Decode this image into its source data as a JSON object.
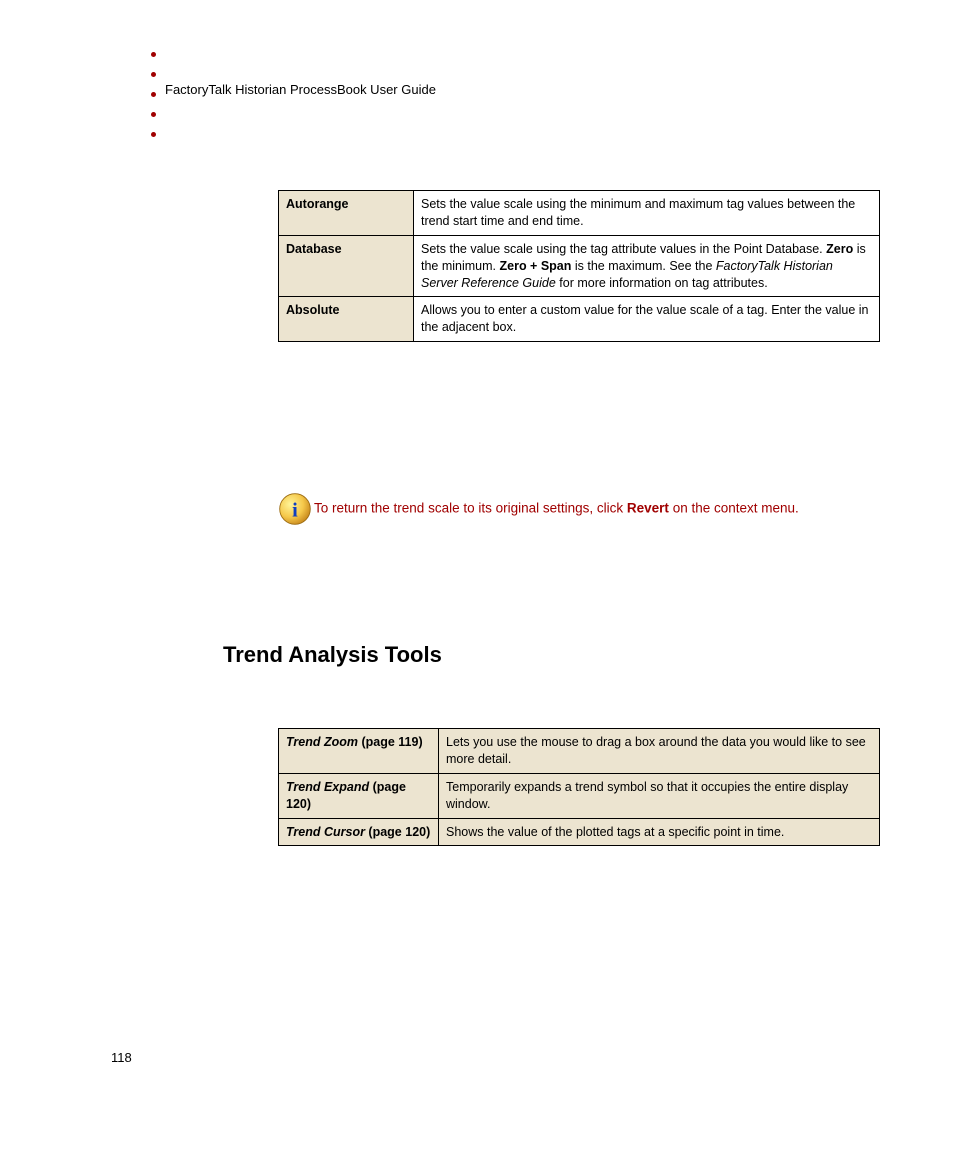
{
  "header": {
    "running_title": "FactoryTalk Historian ProcessBook User Guide"
  },
  "table1": {
    "rows": [
      {
        "label": "Autorange",
        "desc": "Sets the value scale using the minimum and maximum tag values between the trend start time and end time."
      },
      {
        "label": "Database",
        "desc_pre": "Sets the value scale using the tag attribute values in the Point Database. ",
        "bold1": "Zero",
        "mid1": " is the minimum. ",
        "bold2": "Zero + Span",
        "mid2": " is the maximum. See the ",
        "italic": "FactoryTalk Historian Server Reference Guide",
        "post": " for more information on tag attributes."
      },
      {
        "label": "Absolute",
        "desc": "Allows you to enter a custom value for the value scale of a tag. Enter the value in the adjacent box."
      }
    ]
  },
  "note": {
    "pre": "To return the trend scale to its original settings, click ",
    "bold": "Revert",
    "post": " on the context menu."
  },
  "section_heading": "Trend Analysis Tools",
  "table2": {
    "rows": [
      {
        "tool": "Trend Zoom",
        "page": " (page 119)",
        "desc": "Lets you use the mouse to drag a box around the data you would like to see more detail."
      },
      {
        "tool": "Trend Expand",
        "page": " (page 120)",
        "desc": "Temporarily expands a trend symbol so that it occupies the entire display window."
      },
      {
        "tool": "Trend Cursor",
        "page": " (page 120)",
        "desc": "Shows the value of the plotted tags at a specific point in time."
      }
    ]
  },
  "page_number": "118"
}
